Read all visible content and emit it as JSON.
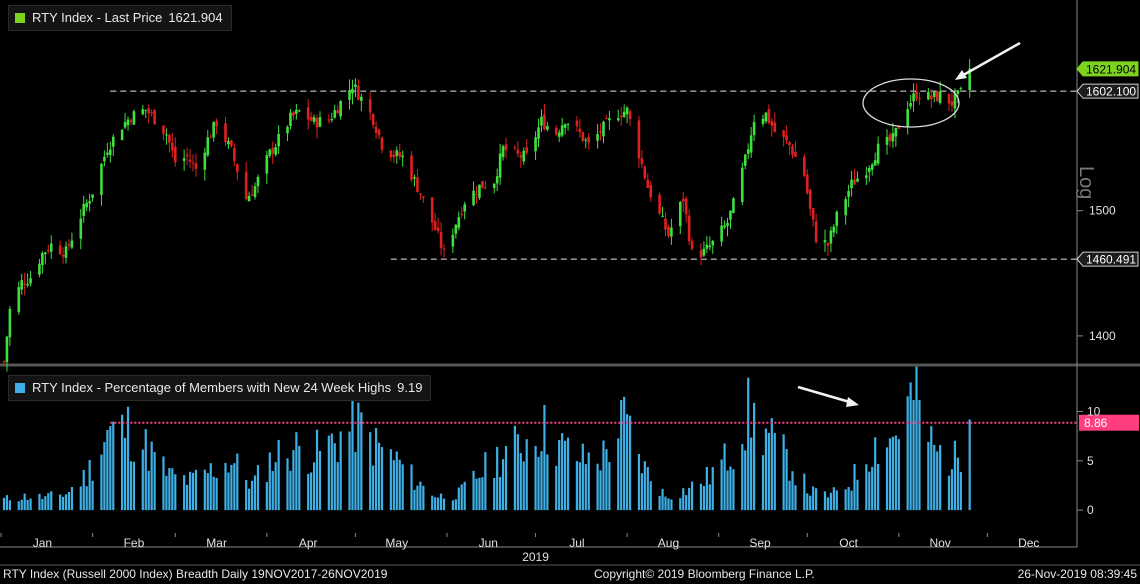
{
  "legend_top": {
    "name": "RTY Index",
    "label": "Last Price",
    "value": "1621.904",
    "color": "#7ed321"
  },
  "legend_bottom": {
    "name": "RTY Index",
    "label": "Percentage of Members with New 24 Week Highs",
    "value": "9.19",
    "color": "#3fb0e6"
  },
  "scale_word": "Log",
  "footer": {
    "left": "RTY Index (Russell 2000 Index) Breadth  Daily 19NOV2017-26NOV2019",
    "middle": "Copyright© 2019 Bloomberg Finance L.P.",
    "right": "26-Nov-2019 08:39:45"
  },
  "chart_data": [
    {
      "type": "candlestick",
      "scale": "log",
      "ylim": [
        1380,
        1680
      ],
      "y_ticks": [
        "1400",
        "1500"
      ],
      "x_ticks": [
        "Jan",
        "Feb",
        "Mar",
        "Apr",
        "May",
        "Jun",
        "Jul",
        "Aug",
        "Sep",
        "Oct",
        "Nov",
        "Dec"
      ],
      "year_label": "2019",
      "up_color": "#3ee03e",
      "down_color": "#e02020",
      "tags": [
        {
          "label": "1621.904",
          "value": 1621.904,
          "style": "last"
        },
        {
          "label": "1602.100",
          "value": 1602.1,
          "style": "level"
        },
        {
          "label": "1460.491",
          "value": 1460.491,
          "style": "level"
        }
      ],
      "levels": [
        {
          "value": 1602.1,
          "from": "2019-02-07"
        },
        {
          "value": 1460.491,
          "from": "2019-05-13"
        }
      ],
      "close_points": [
        [
          "2019-01-02",
          1380
        ],
        [
          "2019-01-04",
          1420
        ],
        [
          "2019-01-08",
          1442
        ],
        [
          "2019-01-11",
          1446
        ],
        [
          "2019-01-15",
          1465
        ],
        [
          "2019-01-18",
          1472
        ],
        [
          "2019-01-23",
          1466
        ],
        [
          "2019-01-28",
          1496
        ],
        [
          "2019-02-01",
          1516
        ],
        [
          "2019-02-06",
          1553
        ],
        [
          "2019-02-11",
          1572
        ],
        [
          "2019-02-14",
          1580
        ],
        [
          "2019-02-19",
          1586
        ],
        [
          "2019-02-22",
          1578
        ],
        [
          "2019-02-26",
          1565
        ],
        [
          "2019-03-01",
          1541
        ],
        [
          "2019-03-05",
          1545
        ],
        [
          "2019-03-08",
          1535
        ],
        [
          "2019-03-12",
          1560
        ],
        [
          "2019-03-15",
          1575
        ],
        [
          "2019-03-20",
          1550
        ],
        [
          "2019-03-25",
          1510
        ],
        [
          "2019-03-28",
          1520
        ],
        [
          "2019-04-02",
          1548
        ],
        [
          "2019-04-05",
          1560
        ],
        [
          "2019-04-09",
          1578
        ],
        [
          "2019-04-12",
          1584
        ],
        [
          "2019-04-17",
          1575
        ],
        [
          "2019-04-22",
          1577
        ],
        [
          "2019-04-26",
          1592
        ],
        [
          "2019-04-30",
          1608
        ],
        [
          "2019-05-02",
          1600
        ],
        [
          "2019-05-07",
          1578
        ],
        [
          "2019-05-10",
          1556
        ],
        [
          "2019-05-14",
          1547
        ],
        [
          "2019-05-17",
          1545
        ],
        [
          "2019-05-22",
          1520
        ],
        [
          "2019-05-28",
          1485
        ],
        [
          "2019-05-31",
          1465
        ],
        [
          "2019-06-04",
          1490
        ],
        [
          "2019-06-07",
          1508
        ],
        [
          "2019-06-12",
          1520
        ],
        [
          "2019-06-17",
          1525
        ],
        [
          "2019-06-20",
          1552
        ],
        [
          "2019-06-25",
          1546
        ],
        [
          "2019-06-28",
          1545
        ],
        [
          "2019-07-03",
          1576
        ],
        [
          "2019-07-08",
          1566
        ],
        [
          "2019-07-11",
          1578
        ],
        [
          "2019-07-16",
          1565
        ],
        [
          "2019-07-19",
          1555
        ],
        [
          "2019-07-24",
          1570
        ],
        [
          "2019-07-29",
          1583
        ],
        [
          "2019-08-01",
          1585
        ],
        [
          "2019-08-05",
          1548
        ],
        [
          "2019-08-08",
          1520
        ],
        [
          "2019-08-12",
          1496
        ],
        [
          "2019-08-15",
          1480
        ],
        [
          "2019-08-20",
          1510
        ],
        [
          "2019-08-23",
          1465
        ],
        [
          "2019-08-27",
          1466
        ],
        [
          "2019-08-30",
          1473
        ],
        [
          "2019-09-04",
          1490
        ],
        [
          "2019-09-06",
          1505
        ],
        [
          "2019-09-10",
          1542
        ],
        [
          "2019-09-13",
          1578
        ],
        [
          "2019-09-17",
          1582
        ],
        [
          "2019-09-20",
          1567
        ],
        [
          "2019-09-25",
          1555
        ],
        [
          "2019-09-30",
          1530
        ],
        [
          "2019-10-02",
          1500
        ],
        [
          "2019-10-04",
          1478
        ],
        [
          "2019-10-08",
          1472
        ],
        [
          "2019-10-11",
          1495
        ],
        [
          "2019-10-16",
          1522
        ],
        [
          "2019-10-21",
          1535
        ],
        [
          "2019-10-25",
          1552
        ],
        [
          "2019-10-30",
          1560
        ],
        [
          "2019-11-04",
          1590
        ],
        [
          "2019-11-07",
          1600
        ],
        [
          "2019-11-12",
          1596
        ],
        [
          "2019-11-15",
          1598
        ],
        [
          "2019-11-19",
          1592
        ],
        [
          "2019-11-22",
          1600
        ],
        [
          "2019-11-25",
          1622
        ]
      ]
    },
    {
      "type": "bar",
      "ylim": [
        -1,
        14
      ],
      "y_ticks": [
        "0",
        "5",
        "10"
      ],
      "threshold": {
        "label": "8.86",
        "value": 8.86,
        "color": "#ff3d7f",
        "from": "2019-02-07"
      },
      "bar_points": [
        [
          "2019-01-02",
          1.2
        ],
        [
          "2019-01-09",
          1.5
        ],
        [
          "2019-01-16",
          1.4
        ],
        [
          "2019-01-23",
          1.8
        ],
        [
          "2019-01-30",
          3.8
        ],
        [
          "2019-02-06",
          8.5
        ],
        [
          "2019-02-13",
          8.9
        ],
        [
          "2019-02-20",
          6.5
        ],
        [
          "2019-02-27",
          3.8
        ],
        [
          "2019-03-06",
          3.2
        ],
        [
          "2019-03-13",
          4.3
        ],
        [
          "2019-03-20",
          5.5
        ],
        [
          "2019-03-27",
          2.8
        ],
        [
          "2019-04-03",
          5.8
        ],
        [
          "2019-04-10",
          6.8
        ],
        [
          "2019-04-17",
          6.2
        ],
        [
          "2019-04-24",
          7.5
        ],
        [
          "2019-05-01",
          9.5
        ],
        [
          "2019-05-08",
          7.0
        ],
        [
          "2019-05-15",
          5.5
        ],
        [
          "2019-05-22",
          3.0
        ],
        [
          "2019-05-29",
          1.5
        ],
        [
          "2019-06-05",
          1.8
        ],
        [
          "2019-06-12",
          4.0
        ],
        [
          "2019-06-19",
          6.0
        ],
        [
          "2019-06-26",
          7.2
        ],
        [
          "2019-07-03",
          9.0
        ],
        [
          "2019-07-10",
          6.8
        ],
        [
          "2019-07-17",
          5.5
        ],
        [
          "2019-07-24",
          6.0
        ],
        [
          "2019-07-31",
          9.8
        ],
        [
          "2019-08-07",
          4.5
        ],
        [
          "2019-08-14",
          1.5
        ],
        [
          "2019-08-21",
          2.2
        ],
        [
          "2019-08-28",
          3.5
        ],
        [
          "2019-09-04",
          5.8
        ],
        [
          "2019-09-11",
          10.5
        ],
        [
          "2019-09-18",
          8.0
        ],
        [
          "2019-09-25",
          5.2
        ],
        [
          "2019-10-02",
          2.0
        ],
        [
          "2019-10-09",
          1.6
        ],
        [
          "2019-10-16",
          3.2
        ],
        [
          "2019-10-23",
          7.0
        ],
        [
          "2019-10-30",
          8.0
        ],
        [
          "2019-11-06",
          12.5
        ],
        [
          "2019-11-13",
          6.5
        ],
        [
          "2019-11-20",
          5.5
        ],
        [
          "2019-11-25",
          9.19
        ]
      ]
    }
  ]
}
